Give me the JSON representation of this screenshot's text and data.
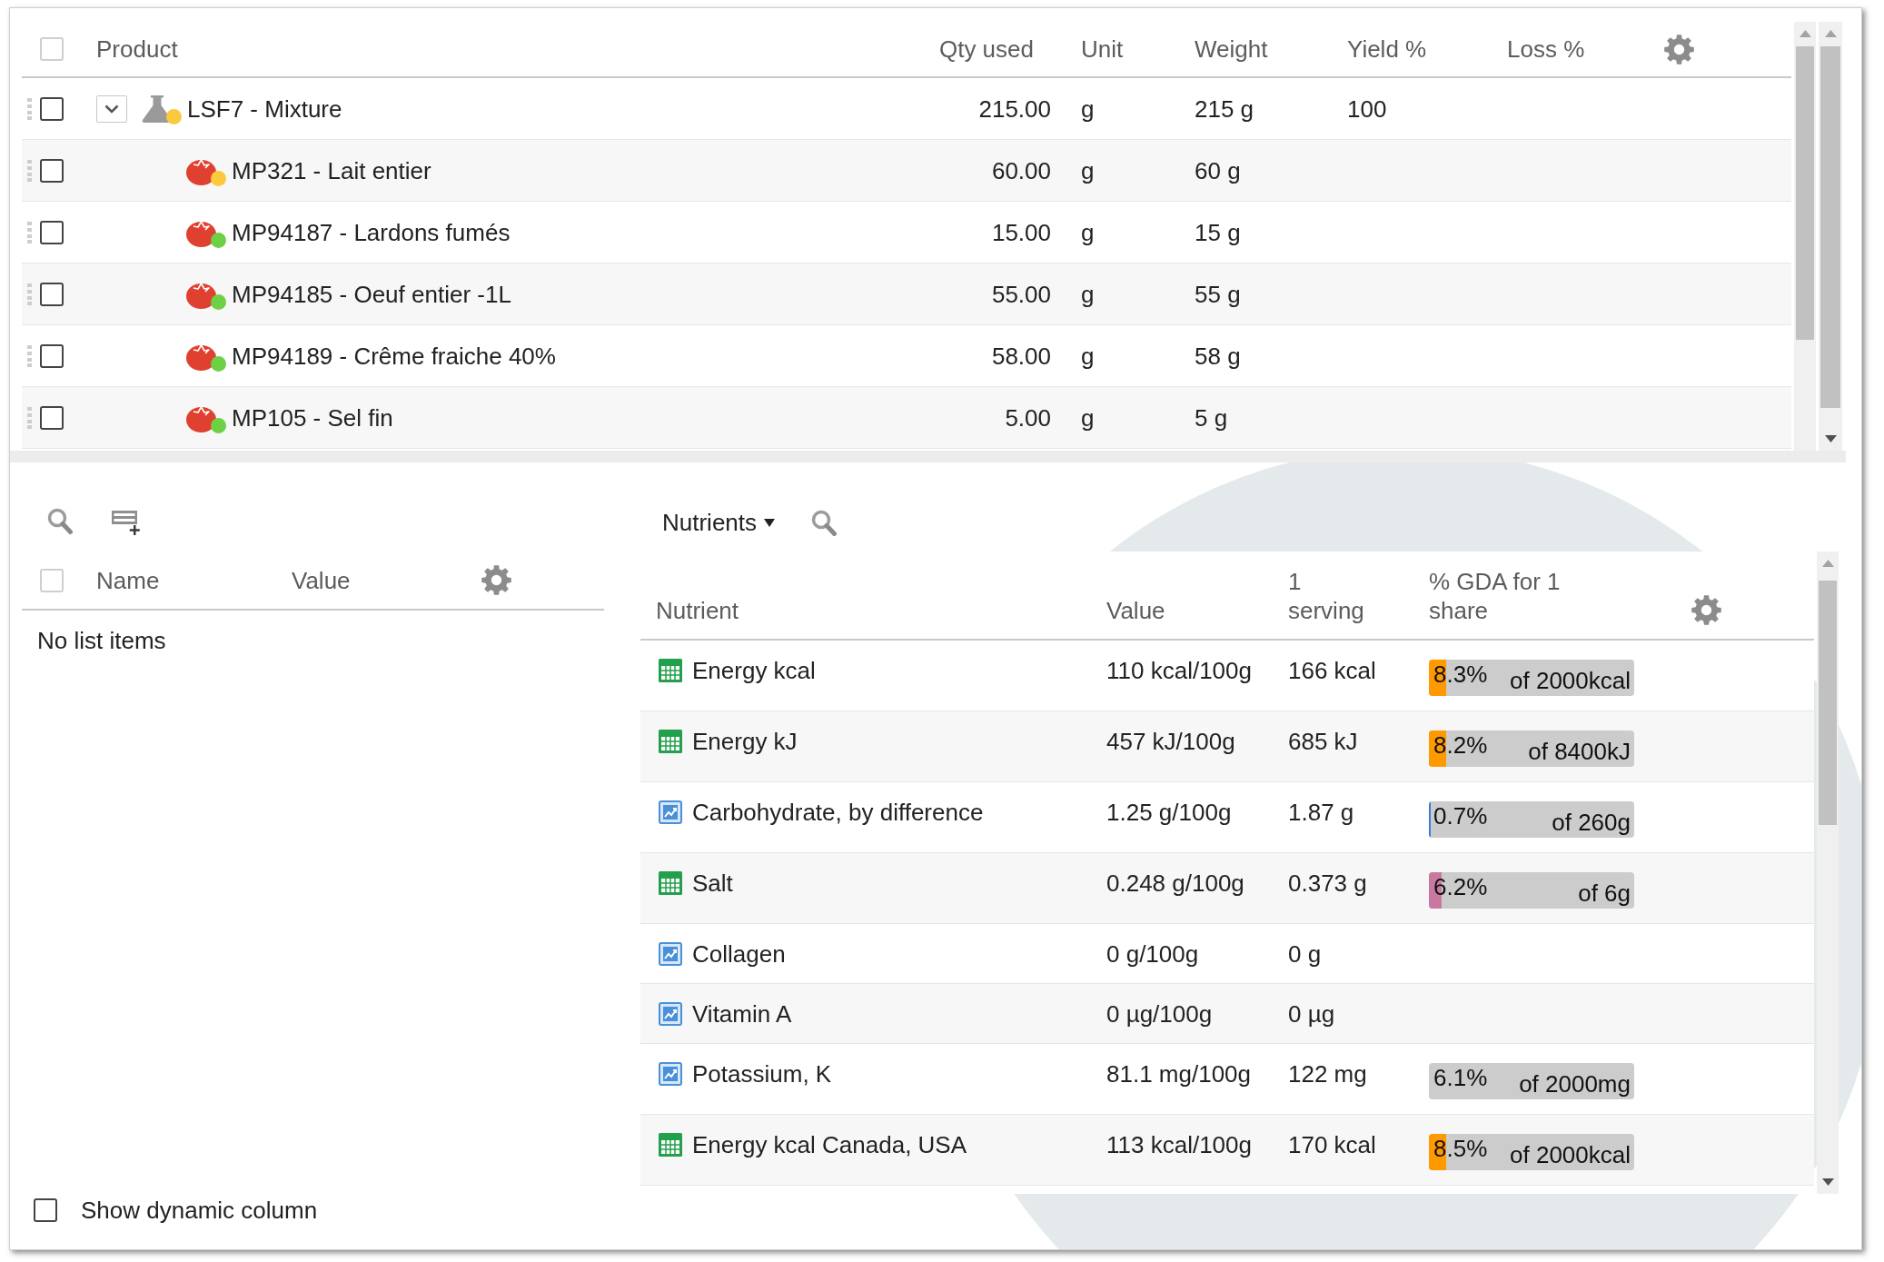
{
  "products_table": {
    "select_all": {
      "checked": false
    },
    "columns": [
      "Product",
      "Qty used",
      "Unit",
      "Weight",
      "Yield %",
      "Loss %"
    ],
    "rows": [
      {
        "kind": "mixture",
        "name": "LSF7 - Mixture",
        "color": "#fbc93d",
        "qty_used": "215.00",
        "unit": "g",
        "weight": "215 g",
        "yield": "100",
        "checked": false,
        "expanded": true,
        "children": [
          {
            "kind": "ingredient",
            "name": "MP321 - Lait entier",
            "color": "#fbc93d",
            "qty_used": "60.00",
            "unit": "g",
            "weight": "60 g",
            "checked": false
          },
          {
            "kind": "ingredient",
            "name": "MP94187 - Lardons fumés",
            "color": "#6dd045",
            "qty_used": "15.00",
            "unit": "g",
            "weight": "15 g",
            "checked": false
          },
          {
            "kind": "ingredient",
            "name": "MP94185 - Oeuf entier -1L",
            "color": "#6dd045",
            "qty_used": "55.00",
            "unit": "g",
            "weight": "55 g",
            "checked": false
          },
          {
            "kind": "ingredient",
            "name": "MP94189 - Crême fraiche 40%",
            "color": "#6dd045",
            "qty_used": "58.00",
            "unit": "g",
            "weight": "58 g",
            "checked": false
          },
          {
            "kind": "ingredient",
            "name": "MP105 - Sel fin",
            "color": "#6dd045",
            "qty_used": "5.00",
            "unit": "g",
            "weight": "5 g",
            "checked": false
          }
        ]
      }
    ]
  },
  "properties_panel": {
    "select_all": {
      "checked": false
    },
    "columns": [
      "Name",
      "Value"
    ],
    "empty_message": "No list items",
    "show_dynamic_column": {
      "label": "Show dynamic column",
      "checked": false
    }
  },
  "nutrients_panel": {
    "selector": "Nutrients",
    "columns": [
      "Nutrient",
      "Value",
      "1 serving",
      "% GDA for 1 share"
    ],
    "rows": [
      {
        "kind": "grid",
        "name": "Energy kcal",
        "value": "110 kcal/100g",
        "serving": "166 kcal",
        "gda": {
          "percent": "8.3%",
          "reference": "of 2000kcal",
          "level": 0.083,
          "color": "#ff9900"
        }
      },
      {
        "kind": "grid",
        "name": "Energy kJ",
        "value": "457 kJ/100g",
        "serving": "685 kJ",
        "gda": {
          "percent": "8.2%",
          "reference": "of 8400kJ",
          "level": 0.082,
          "color": "#ff9900"
        }
      },
      {
        "kind": "chart",
        "name": "Carbohydrate, by difference",
        "value": "1.25 g/100g",
        "serving": "1.87 g",
        "gda": {
          "percent": "0.7%",
          "reference": "of 260g",
          "level": 0.007,
          "color": "#3a7bd5"
        }
      },
      {
        "kind": "grid",
        "name": "Salt",
        "value": "0.248 g/100g",
        "serving": "0.373 g",
        "gda": {
          "percent": "6.2%",
          "reference": "of 6g",
          "level": 0.062,
          "color": "#c9799f"
        }
      },
      {
        "kind": "chart",
        "name": "Collagen",
        "value": "0 g/100g",
        "serving": "0 g"
      },
      {
        "kind": "chart",
        "name": "Vitamin A",
        "value": "0 µg/100g",
        "serving": "0 µg"
      },
      {
        "kind": "chart",
        "name": "Potassium, K",
        "value": "81.1 mg/100g",
        "serving": "122 mg",
        "gda": {
          "percent": "6.1%",
          "reference": "of 2000mg"
        }
      },
      {
        "kind": "grid",
        "name": "Energy kcal Canada, USA",
        "value": "113 kcal/100g",
        "serving": "170 kcal",
        "gda": {
          "percent": "8.5%",
          "reference": "of 2000kcal",
          "level": 0.085,
          "color": "#ff9900"
        }
      }
    ]
  }
}
